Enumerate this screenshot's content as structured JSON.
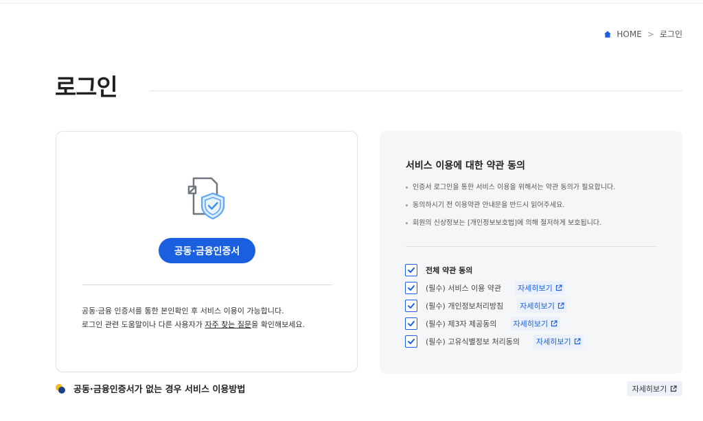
{
  "breadcrumb": {
    "home": "HOME",
    "separator": ">",
    "current": "로그인"
  },
  "page": {
    "title": "로그인"
  },
  "cert_card": {
    "button_label": "공동·금융인증서",
    "desc_line1": "공동·금융 인증서를 통한 본인확인 후 서비스 이용이 가능합니다.",
    "desc_line2_prefix": "로그인 관련 도움말이나 다른 사용자가 ",
    "desc_line2_link": "자주 찾는 질문",
    "desc_line2_suffix": "을 확인해보세요."
  },
  "terms": {
    "title": "서비스 이용에 대한 약관 동의",
    "notes": [
      "인증서 로그인을 통한 서비스 이용을 위해서는 약관 동의가 필요합니다.",
      "동의하시기 전 이용약관 안내문을 반드시 읽어주세요.",
      "회원의 신상정보는 [개인정보보호법]에 의해 철저하게 보호됩니다."
    ],
    "all_agree": "전체 약관 동의",
    "items": [
      {
        "label": "(필수) 서비스 이용 약관",
        "link": "자세히보기"
      },
      {
        "label": "(필수) 개인정보처리방침",
        "link": "자세히보기"
      },
      {
        "label": "(필수) 제3자 제공동의",
        "link": "자세히보기"
      },
      {
        "label": "(필수) 고유식별정보 처리동의",
        "link": "자세히보기"
      }
    ]
  },
  "bottom": {
    "title": "공동·금융인증서가 없는 경우 서비스 이용방법",
    "detail_label": "자세히보기"
  },
  "colors": {
    "accent": "#1a5fe0",
    "panel_bg": "#f5f6f8",
    "bullet_yellow": "#f3b623",
    "bullet_navy": "#1d3f8a"
  },
  "icons": {
    "breadcrumb_home": "home-icon",
    "cert": "document-shield-icon",
    "checkbox": "checkmark-icon",
    "external_link": "external-link-icon"
  },
  "state": {
    "all_checked": true,
    "items_checked": [
      true,
      true,
      true,
      true
    ]
  }
}
